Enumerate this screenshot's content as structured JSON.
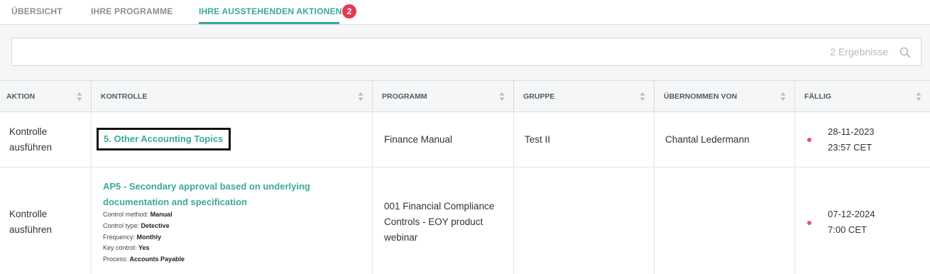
{
  "tabs": [
    {
      "label": "ÜBERSICHT"
    },
    {
      "label": "IHRE PROGRAMME"
    },
    {
      "label": "IHRE AUSSTEHENDEN AKTIONEN",
      "badge": "2"
    }
  ],
  "search": {
    "value": "",
    "result_count": "2 Ergebnisse",
    "icon": "search-icon"
  },
  "table": {
    "columns": [
      {
        "label": "AKTION"
      },
      {
        "label": "KONTROLLE"
      },
      {
        "label": "PROGRAMM"
      },
      {
        "label": "GRUPPE"
      },
      {
        "label": "ÜBERNOMMEN VON"
      },
      {
        "label": "FÄLLIG"
      }
    ],
    "rows": [
      {
        "aktion": [
          "Kontrolle",
          "ausführen"
        ],
        "kontrolle": "5. Other Accounting Topics",
        "programm": [
          "Finance Manual"
        ],
        "gruppe": "Test II",
        "uebernommen": "Chantal Ledermann",
        "faellig_date": "28-11-2023",
        "faellig_time": "23:57 CET"
      },
      {
        "aktion": [
          "Kontrolle",
          "ausführen"
        ],
        "kontrolle": [
          "AP5 - Secondary approval based on underlying",
          "documentation and specification"
        ],
        "details": [
          {
            "label": "Control method:",
            "value": "Manual"
          },
          {
            "label": "Control type:",
            "value": "Detective"
          },
          {
            "label": "Frequency:",
            "value": "Monthly"
          },
          {
            "label": "Key control:",
            "value": "Yes"
          },
          {
            "label": "Process:",
            "value": "Accounts Payable"
          }
        ],
        "programm": [
          "001 Financial Compliance",
          "Controls - EOY product",
          "webinar"
        ],
        "gruppe": "",
        "uebernommen": "",
        "faellig_date": "07-12-2024",
        "faellig_time": "7:00 CET"
      }
    ]
  },
  "colors": {
    "accent": "#3aa89b",
    "badge": "#e53950",
    "overdue_dot": "#e85262"
  }
}
